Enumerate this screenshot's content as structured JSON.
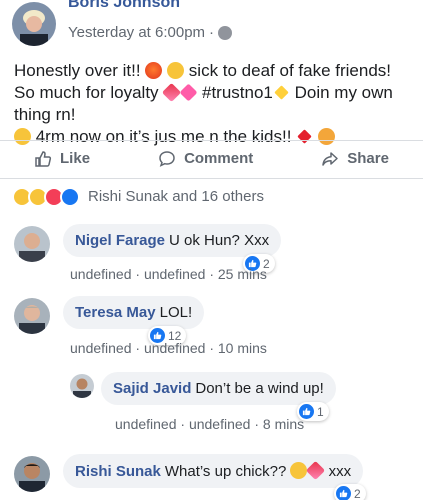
{
  "post": {
    "author": "Boris Johnson",
    "timestamp": "Yesterday at 6:00pm",
    "separator": "·",
    "text_parts": [
      "Honestly over it!! ",
      " sick to deaf of fake friends! So much for loyalty ",
      " #trustno1",
      " Doin my own thing rn! ",
      " 4rm now on it’s jus me n the kids!! "
    ],
    "emojis": [
      "angry-face",
      "eye-roll-face",
      "broken-heart",
      "pink-heart",
      "sparkles",
      "kiss-face",
      "red-heart",
      "heart-eyes-cat"
    ]
  },
  "actions": {
    "like": "Like",
    "comment": "Comment",
    "share": "Share"
  },
  "reactions": {
    "icons": [
      "wow",
      "haha",
      "love",
      "like"
    ],
    "summary": "Rishi Sunak and 16 others"
  },
  "comments": [
    {
      "name": "Nigel Farage",
      "text": "U ok Hun? Xxx",
      "meta": "undefined · undefined · 25 mins",
      "likes": "2"
    },
    {
      "name": "Teresa May",
      "text": "LOL!",
      "meta": "undefined · undefined · 10 mins",
      "likes": "12"
    },
    {
      "name": "Sajid Javid",
      "text": "Don’t be a wind up!",
      "meta": "undefined · undefined · 8 mins",
      "likes": "1"
    },
    {
      "name": "Rishi Sunak",
      "text": "What’s up chick?? ",
      "text_after": " xxx",
      "likes": "2"
    }
  ],
  "colors": {
    "name_blue": "#385898",
    "like_blue": "#1877f2",
    "bubble_bg": "#f0f2f5",
    "muted": "#606770"
  }
}
